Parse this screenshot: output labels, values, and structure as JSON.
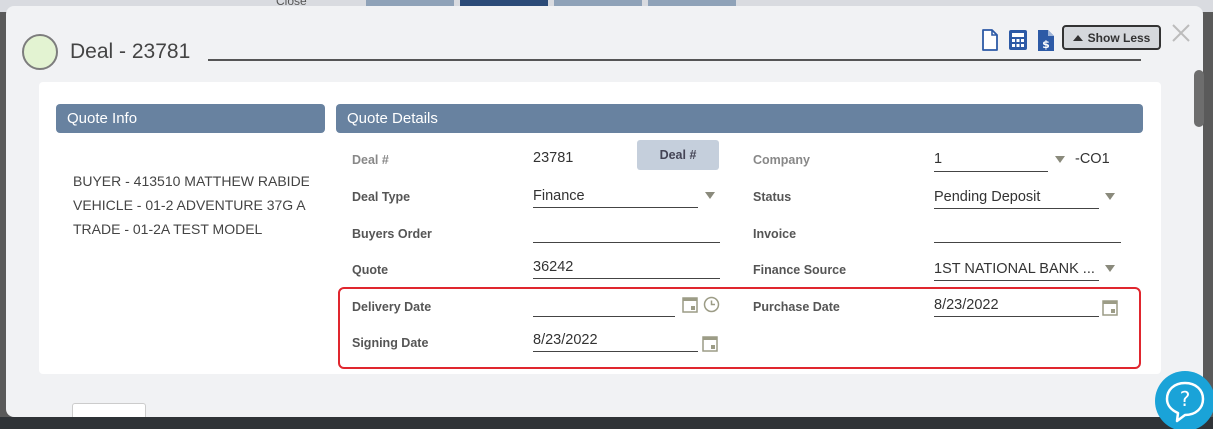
{
  "background": {
    "close_label": "Close"
  },
  "dialog": {
    "title": "Deal - 23781",
    "show_less_label": "Show Less"
  },
  "quote_info": {
    "header": "Quote Info",
    "lines": [
      "BUYER - 413510 MATTHEW RABIDEAU",
      "VEHICLE - 01-2 ADVENTURE 37G  A",
      "TRADE - 01-2A TEST MODEL"
    ]
  },
  "quote_details": {
    "header": "Quote Details",
    "deal_number": {
      "label": "Deal #",
      "value": "23781",
      "button_label": "Deal #"
    },
    "company": {
      "label": "Company",
      "value": "1",
      "suffix": "-CO1"
    },
    "deal_type": {
      "label": "Deal Type",
      "value": "Finance"
    },
    "status": {
      "label": "Status",
      "value": "Pending Deposit"
    },
    "buyers_order": {
      "label": "Buyers Order",
      "value": ""
    },
    "invoice": {
      "label": "Invoice",
      "value": ""
    },
    "quote": {
      "label": "Quote",
      "value": "36242"
    },
    "finance_source": {
      "label": "Finance Source",
      "value": "1ST NATIONAL BANK ..."
    },
    "delivery_date": {
      "label": "Delivery Date",
      "value": ""
    },
    "purchase_date": {
      "label": "Purchase Date",
      "value": "8/23/2022"
    },
    "signing_date": {
      "label": "Signing Date",
      "value": "8/23/2022"
    }
  },
  "icons": {
    "document": "document-icon",
    "calculator": "calculator-icon",
    "invoice": "dollar-document-icon",
    "calendar": "calendar-icon",
    "clock": "clock-icon",
    "close": "close-icon",
    "help": "help-chat-icon"
  },
  "colors": {
    "header_bg": "#6882a0",
    "icon_blue": "#2d5aa6",
    "highlight": "#e0262e",
    "help_button": "#1aa3d8"
  }
}
